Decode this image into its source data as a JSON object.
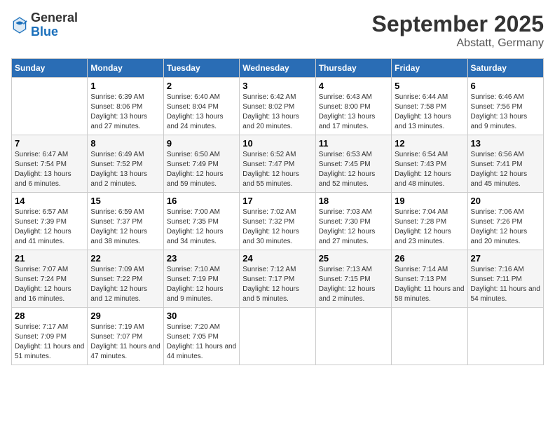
{
  "logo": {
    "general": "General",
    "blue": "Blue"
  },
  "title": {
    "month_year": "September 2025",
    "location": "Abstatt, Germany"
  },
  "headers": [
    "Sunday",
    "Monday",
    "Tuesday",
    "Wednesday",
    "Thursday",
    "Friday",
    "Saturday"
  ],
  "weeks": [
    [
      {
        "day": "",
        "info": ""
      },
      {
        "day": "1",
        "info": "Sunrise: 6:39 AM\nSunset: 8:06 PM\nDaylight: 13 hours and 27 minutes."
      },
      {
        "day": "2",
        "info": "Sunrise: 6:40 AM\nSunset: 8:04 PM\nDaylight: 13 hours and 24 minutes."
      },
      {
        "day": "3",
        "info": "Sunrise: 6:42 AM\nSunset: 8:02 PM\nDaylight: 13 hours and 20 minutes."
      },
      {
        "day": "4",
        "info": "Sunrise: 6:43 AM\nSunset: 8:00 PM\nDaylight: 13 hours and 17 minutes."
      },
      {
        "day": "5",
        "info": "Sunrise: 6:44 AM\nSunset: 7:58 PM\nDaylight: 13 hours and 13 minutes."
      },
      {
        "day": "6",
        "info": "Sunrise: 6:46 AM\nSunset: 7:56 PM\nDaylight: 13 hours and 9 minutes."
      }
    ],
    [
      {
        "day": "7",
        "info": "Sunrise: 6:47 AM\nSunset: 7:54 PM\nDaylight: 13 hours and 6 minutes."
      },
      {
        "day": "8",
        "info": "Sunrise: 6:49 AM\nSunset: 7:52 PM\nDaylight: 13 hours and 2 minutes."
      },
      {
        "day": "9",
        "info": "Sunrise: 6:50 AM\nSunset: 7:49 PM\nDaylight: 12 hours and 59 minutes."
      },
      {
        "day": "10",
        "info": "Sunrise: 6:52 AM\nSunset: 7:47 PM\nDaylight: 12 hours and 55 minutes."
      },
      {
        "day": "11",
        "info": "Sunrise: 6:53 AM\nSunset: 7:45 PM\nDaylight: 12 hours and 52 minutes."
      },
      {
        "day": "12",
        "info": "Sunrise: 6:54 AM\nSunset: 7:43 PM\nDaylight: 12 hours and 48 minutes."
      },
      {
        "day": "13",
        "info": "Sunrise: 6:56 AM\nSunset: 7:41 PM\nDaylight: 12 hours and 45 minutes."
      }
    ],
    [
      {
        "day": "14",
        "info": "Sunrise: 6:57 AM\nSunset: 7:39 PM\nDaylight: 12 hours and 41 minutes."
      },
      {
        "day": "15",
        "info": "Sunrise: 6:59 AM\nSunset: 7:37 PM\nDaylight: 12 hours and 38 minutes."
      },
      {
        "day": "16",
        "info": "Sunrise: 7:00 AM\nSunset: 7:35 PM\nDaylight: 12 hours and 34 minutes."
      },
      {
        "day": "17",
        "info": "Sunrise: 7:02 AM\nSunset: 7:32 PM\nDaylight: 12 hours and 30 minutes."
      },
      {
        "day": "18",
        "info": "Sunrise: 7:03 AM\nSunset: 7:30 PM\nDaylight: 12 hours and 27 minutes."
      },
      {
        "day": "19",
        "info": "Sunrise: 7:04 AM\nSunset: 7:28 PM\nDaylight: 12 hours and 23 minutes."
      },
      {
        "day": "20",
        "info": "Sunrise: 7:06 AM\nSunset: 7:26 PM\nDaylight: 12 hours and 20 minutes."
      }
    ],
    [
      {
        "day": "21",
        "info": "Sunrise: 7:07 AM\nSunset: 7:24 PM\nDaylight: 12 hours and 16 minutes."
      },
      {
        "day": "22",
        "info": "Sunrise: 7:09 AM\nSunset: 7:22 PM\nDaylight: 12 hours and 12 minutes."
      },
      {
        "day": "23",
        "info": "Sunrise: 7:10 AM\nSunset: 7:19 PM\nDaylight: 12 hours and 9 minutes."
      },
      {
        "day": "24",
        "info": "Sunrise: 7:12 AM\nSunset: 7:17 PM\nDaylight: 12 hours and 5 minutes."
      },
      {
        "day": "25",
        "info": "Sunrise: 7:13 AM\nSunset: 7:15 PM\nDaylight: 12 hours and 2 minutes."
      },
      {
        "day": "26",
        "info": "Sunrise: 7:14 AM\nSunset: 7:13 PM\nDaylight: 11 hours and 58 minutes."
      },
      {
        "day": "27",
        "info": "Sunrise: 7:16 AM\nSunset: 7:11 PM\nDaylight: 11 hours and 54 minutes."
      }
    ],
    [
      {
        "day": "28",
        "info": "Sunrise: 7:17 AM\nSunset: 7:09 PM\nDaylight: 11 hours and 51 minutes."
      },
      {
        "day": "29",
        "info": "Sunrise: 7:19 AM\nSunset: 7:07 PM\nDaylight: 11 hours and 47 minutes."
      },
      {
        "day": "30",
        "info": "Sunrise: 7:20 AM\nSunset: 7:05 PM\nDaylight: 11 hours and 44 minutes."
      },
      {
        "day": "",
        "info": ""
      },
      {
        "day": "",
        "info": ""
      },
      {
        "day": "",
        "info": ""
      },
      {
        "day": "",
        "info": ""
      }
    ]
  ]
}
